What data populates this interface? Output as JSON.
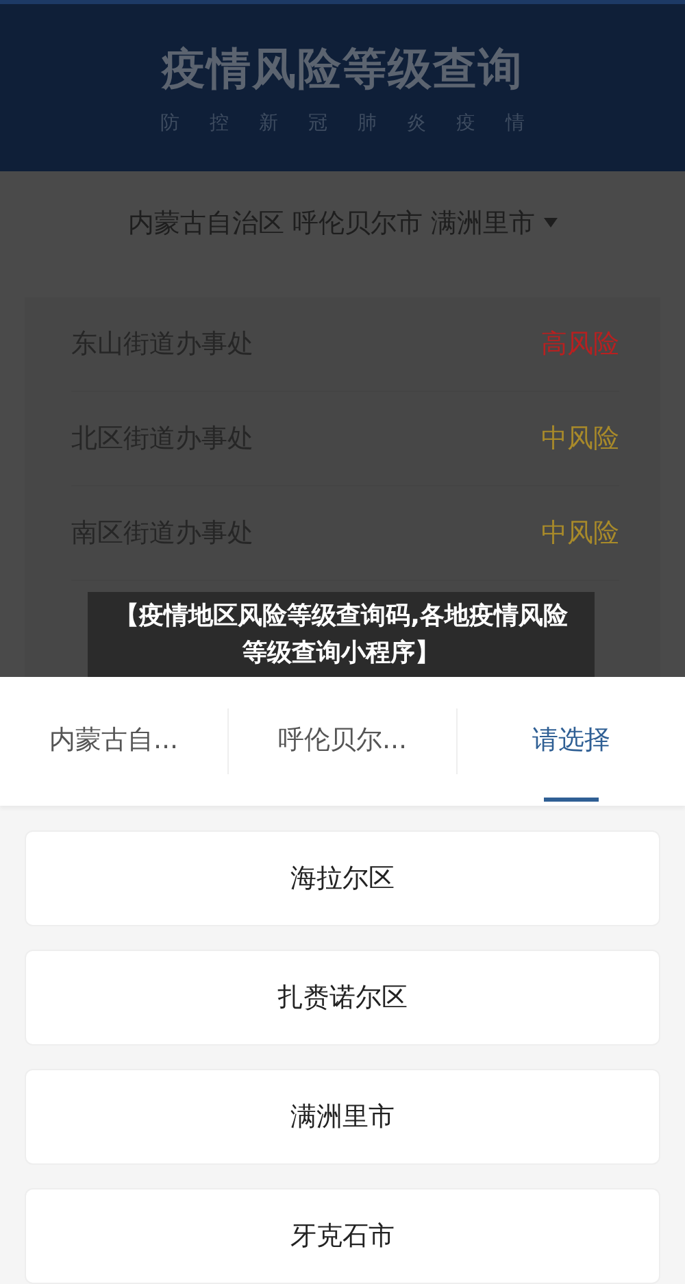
{
  "header": {
    "title": "疫情风险等级查询",
    "subtitle": [
      "防",
      "控",
      "新",
      "冠",
      "肺",
      "炎",
      "疫",
      "情"
    ]
  },
  "location": {
    "text": "内蒙古自治区 呼伦贝尔市 满洲里市"
  },
  "areas": [
    {
      "name": "东山街道办事处",
      "risk": "高风险",
      "kind": "high"
    },
    {
      "name": "北区街道办事处",
      "risk": "中风险",
      "kind": "medium"
    },
    {
      "name": "南区街道办事处",
      "risk": "中风险",
      "kind": "medium"
    }
  ],
  "caption": "【疫情地区风险等级查询码,各地疫情风险等级查询小程序】",
  "tabs": [
    {
      "label": "内蒙古自...",
      "selected": false
    },
    {
      "label": "呼伦贝尔...",
      "selected": false
    },
    {
      "label": "请选择",
      "selected": true
    }
  ],
  "options": [
    "海拉尔区",
    "扎赉诺尔区",
    "满洲里市",
    "牙克石市"
  ]
}
